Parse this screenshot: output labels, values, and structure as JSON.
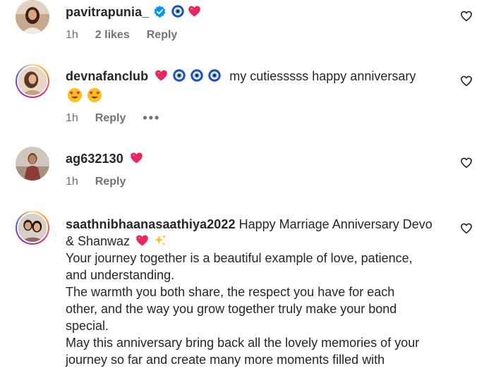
{
  "comments": [
    {
      "username": "pavitrapunia_",
      "text_lines": [],
      "time": "1h",
      "likes": "2 likes",
      "reply": "Reply",
      "more": ""
    },
    {
      "username": "devnafanclub",
      "text_lines": [
        "my cutiesssss happy anniversary"
      ],
      "time": "1h",
      "likes": "",
      "reply": "Reply",
      "more": "•••"
    },
    {
      "username": "ag632130",
      "text_lines": [],
      "time": "1h",
      "likes": "",
      "reply": "Reply",
      "more": ""
    },
    {
      "username": "saathnibhaanasaathiya2022",
      "first_line": "Happy Marriage Anniversary Devo",
      "second_line": "& Shanwaz",
      "text_lines": [
        "Your journey together is a beautiful example of love, patience,",
        "and understanding.",
        "The warmth you both share, the respect you have for each",
        "other, and the way you grow together truly make your bond",
        "special.",
        "May this anniversary bring back all the lovely memories of your",
        "journey so far and create many more moments filled with"
      ]
    }
  ],
  "icons": {
    "like": "heart-outline-icon",
    "verified": "verified-badge-icon",
    "emoji_heart": "red-heart-emoji",
    "emoji_eye": "nazar-amulet-emoji",
    "emoji_heart_eyes": "heart-eyes-emoji",
    "emoji_sparkles": "sparkles-emoji"
  },
  "colors": {
    "text": "#262626",
    "secondary": "#737373",
    "verified": "#0095f6",
    "heart": "#e8265e"
  }
}
